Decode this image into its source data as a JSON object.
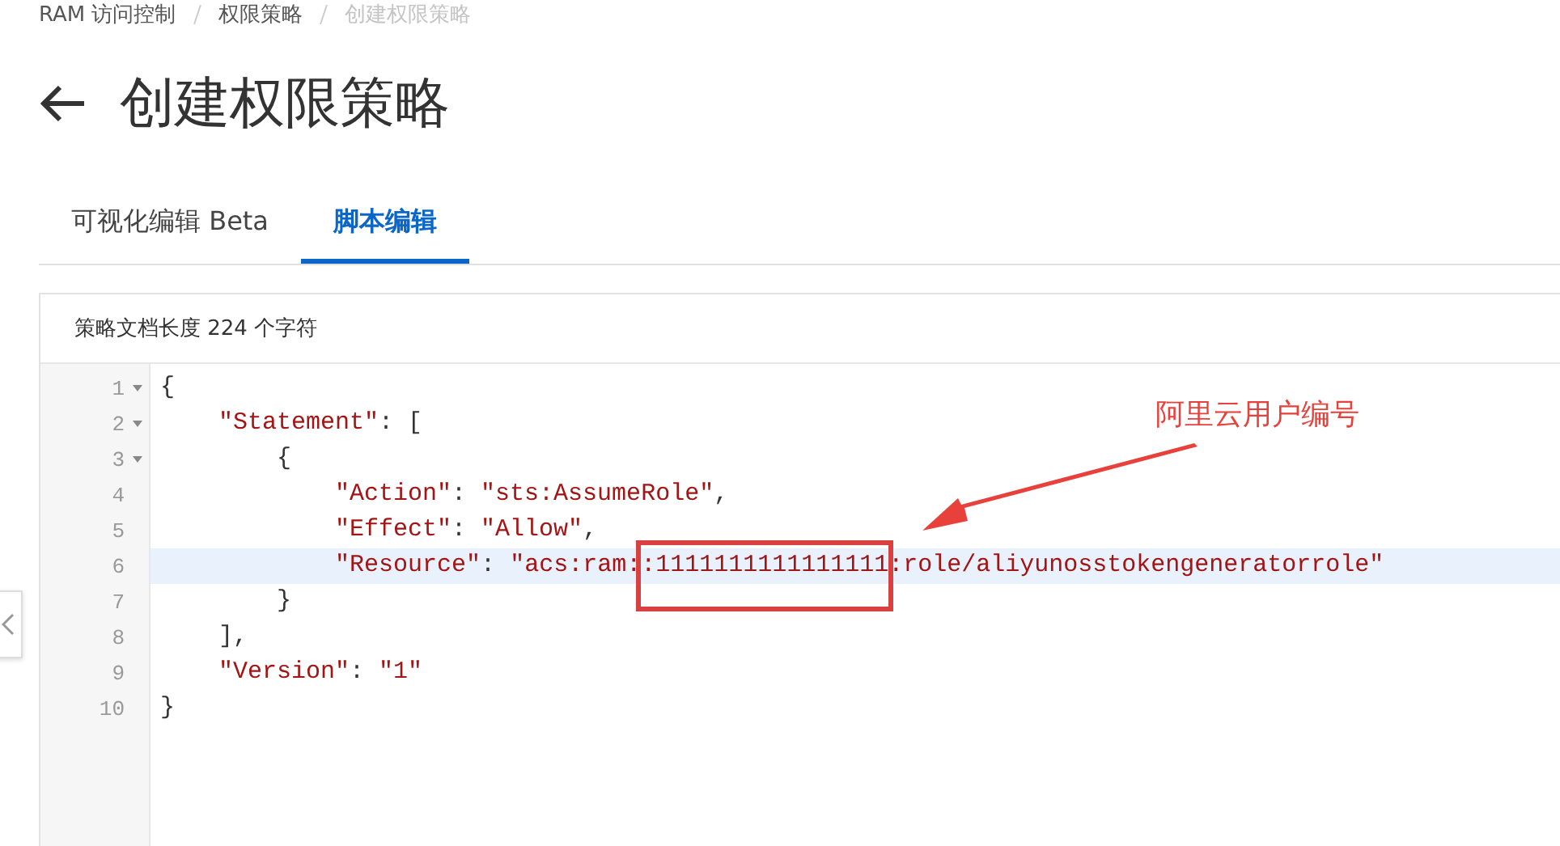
{
  "breadcrumb": [
    {
      "label": "RAM 访问控制",
      "current": false
    },
    {
      "label": "权限策略",
      "current": false
    },
    {
      "label": "创建权限策略",
      "current": true
    }
  ],
  "page_title": "创建权限策略",
  "tabs": [
    {
      "label": "可视化编辑 Beta",
      "selected": false
    },
    {
      "label": "脚本编辑",
      "selected": true
    }
  ],
  "editor": {
    "header": "策略文档长度 224 个字符",
    "lines": [
      {
        "number": "1",
        "foldable": true,
        "highlighted": false,
        "tokens": [
          {
            "kind": "punct",
            "text": "{"
          }
        ]
      },
      {
        "number": "2",
        "foldable": true,
        "highlighted": false,
        "tokens": [
          {
            "kind": "string",
            "text": "    \"Statement\""
          },
          {
            "kind": "punct",
            "text": ": ["
          }
        ]
      },
      {
        "number": "3",
        "foldable": true,
        "highlighted": false,
        "tokens": [
          {
            "kind": "punct",
            "text": "        {"
          }
        ]
      },
      {
        "number": "4",
        "foldable": false,
        "highlighted": false,
        "tokens": [
          {
            "kind": "string",
            "text": "            \"Action\""
          },
          {
            "kind": "punct",
            "text": ": "
          },
          {
            "kind": "string",
            "text": "\"sts:AssumeRole\""
          },
          {
            "kind": "punct",
            "text": ","
          }
        ]
      },
      {
        "number": "5",
        "foldable": false,
        "highlighted": false,
        "tokens": [
          {
            "kind": "string",
            "text": "            \"Effect\""
          },
          {
            "kind": "punct",
            "text": ": "
          },
          {
            "kind": "string",
            "text": "\"Allow\""
          },
          {
            "kind": "punct",
            "text": ","
          }
        ]
      },
      {
        "number": "6",
        "foldable": false,
        "highlighted": true,
        "tokens": [
          {
            "kind": "string",
            "text": "            \"Resource\""
          },
          {
            "kind": "punct",
            "text": ": "
          },
          {
            "kind": "string",
            "text": "\"acs:ram:"
          },
          {
            "kind": "boxed",
            "text": ":1111111111111111"
          },
          {
            "kind": "string",
            "text": ":role/aliyunosstokengeneratorrole\""
          }
        ]
      },
      {
        "number": "7",
        "foldable": false,
        "highlighted": false,
        "tokens": [
          {
            "kind": "punct",
            "text": "        }"
          }
        ]
      },
      {
        "number": "8",
        "foldable": false,
        "highlighted": false,
        "tokens": [
          {
            "kind": "punct",
            "text": "    ],"
          }
        ]
      },
      {
        "number": "9",
        "foldable": false,
        "highlighted": false,
        "tokens": [
          {
            "kind": "string",
            "text": "    \"Version\""
          },
          {
            "kind": "punct",
            "text": ": "
          },
          {
            "kind": "string",
            "text": "\"1\""
          }
        ]
      },
      {
        "number": "10",
        "foldable": false,
        "highlighted": false,
        "tokens": [
          {
            "kind": "punct",
            "text": "}"
          }
        ]
      }
    ]
  },
  "annotation": {
    "label": "阿里云用户编号"
  }
}
